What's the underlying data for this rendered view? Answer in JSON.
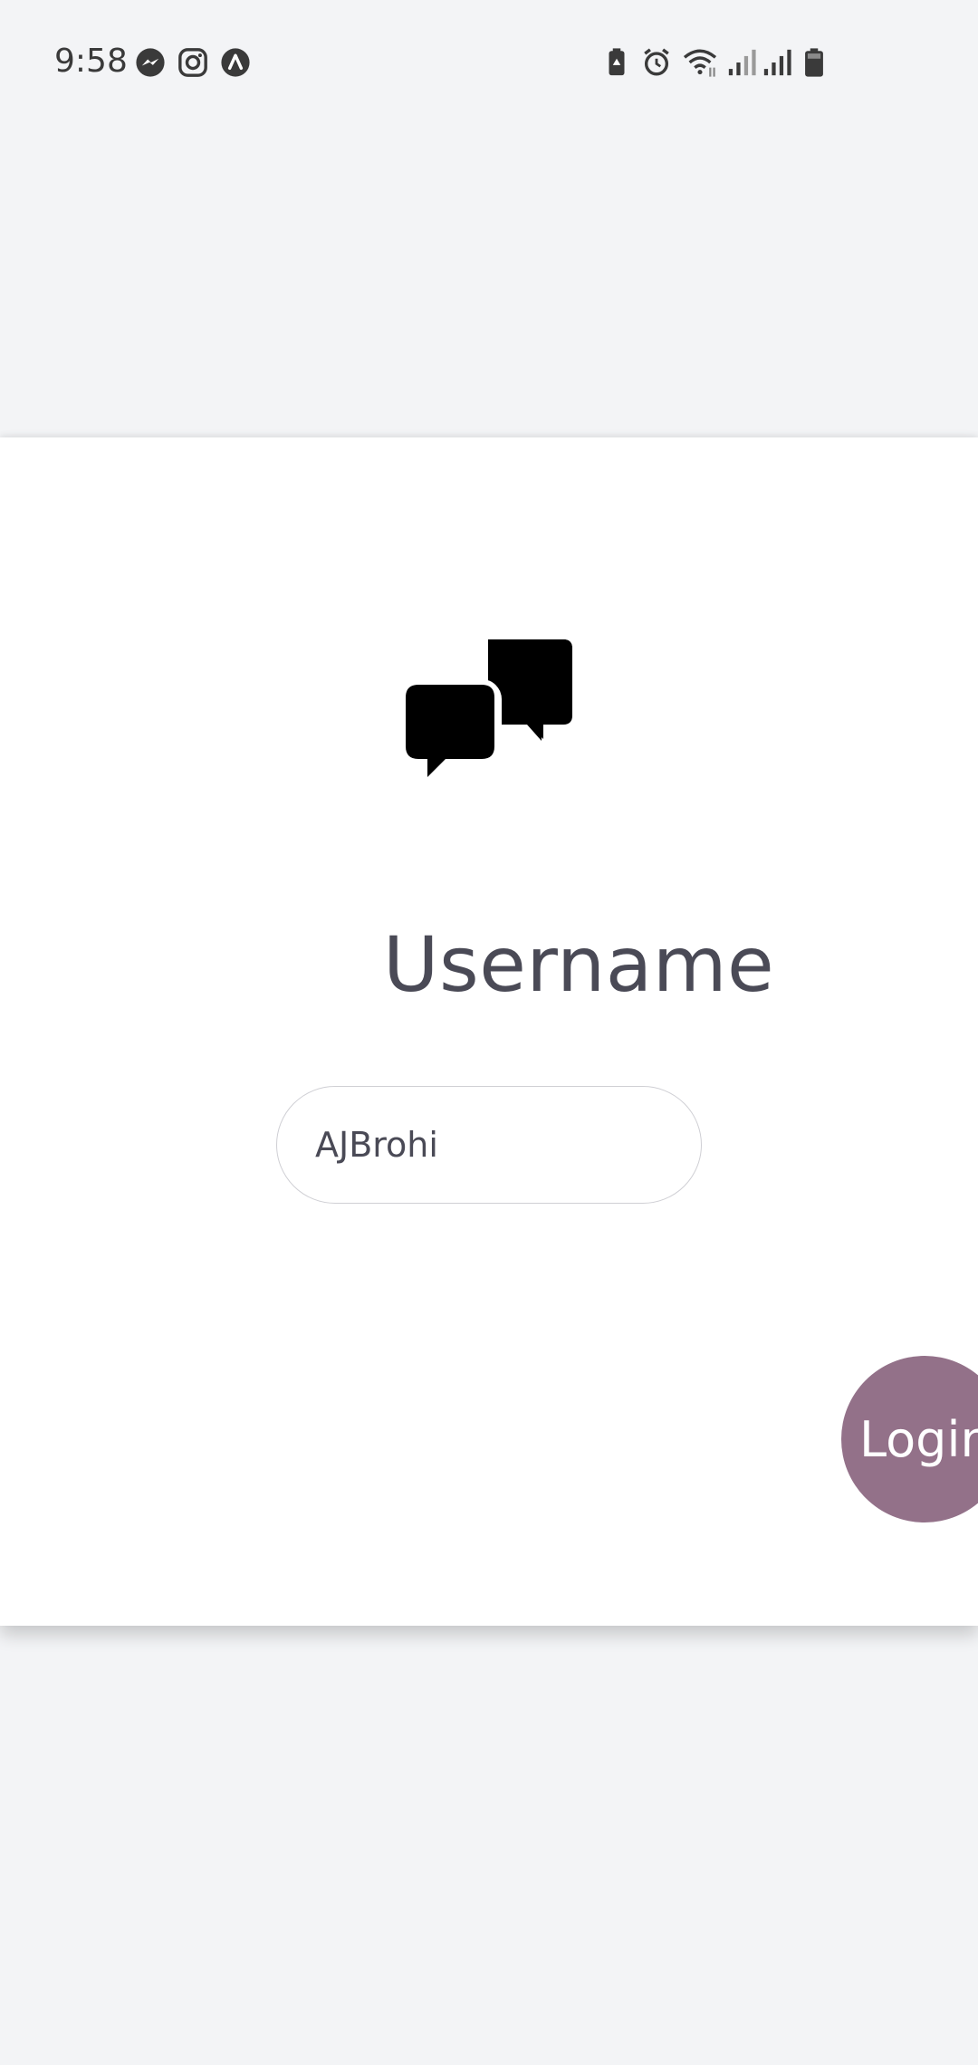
{
  "status_bar": {
    "time": "9:58",
    "left_icons": [
      "messenger-icon",
      "instagram-icon",
      "arc-app-icon"
    ],
    "right_icons": [
      "battery-saver-icon",
      "alarm-icon",
      "wifi-icon",
      "signal-icon",
      "signal-icon",
      "battery-icon"
    ]
  },
  "login": {
    "logo_icon": "chat-bubbles-icon",
    "heading": "Username",
    "username_value": "AJBrohi",
    "login_label": "Login"
  },
  "colors": {
    "background": "#f3f4f6",
    "card": "#ffffff",
    "accent": "#937189",
    "text": "#4a4a56"
  }
}
